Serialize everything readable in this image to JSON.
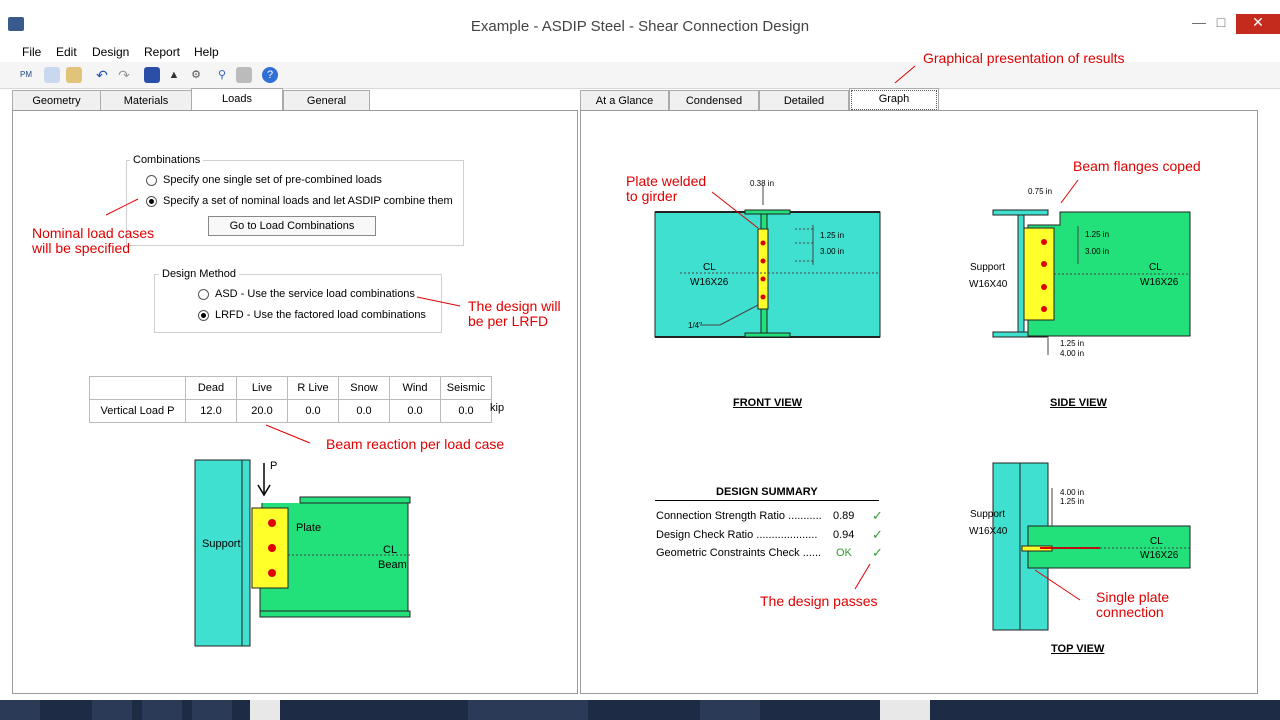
{
  "window": {
    "title": "Example - ASDIP Steel - Shear Connection Design"
  },
  "menu": {
    "items": [
      "File",
      "Edit",
      "Design",
      "Report",
      "Help"
    ]
  },
  "left_tabs": [
    "Geometry",
    "Materials",
    "Loads",
    "General"
  ],
  "right_tabs": [
    "At a Glance",
    "Condensed",
    "Detailed",
    "Graph"
  ],
  "combinations": {
    "label": "Combinations",
    "option1": "Specify one single set of pre-combined loads",
    "option2": "Specify a set of nominal loads and let ASDIP combine them",
    "button": "Go to Load Combinations",
    "selected": 2
  },
  "design_method": {
    "label": "Design Method",
    "option1": "ASD - Use the service load combinations",
    "option2": "LRFD - Use the factored load combinations",
    "selected": 2
  },
  "loads_table": {
    "headers": [
      "Dead",
      "Live",
      "R Live",
      "Snow",
      "Wind",
      "Seismic"
    ],
    "row_label": "Vertical Load  P",
    "values": [
      "12.0",
      "20.0",
      "0.0",
      "0.0",
      "0.0",
      "0.0"
    ],
    "unit": "kip"
  },
  "left_diagram": {
    "load_label": "P",
    "support": "Support",
    "plate": "Plate",
    "cl": "CL",
    "beam": "Beam"
  },
  "annotations": {
    "graphical": "Graphical presentation of results",
    "nominal1": "Nominal load cases",
    "nominal2": "will be specified",
    "lrfd1": "The design will",
    "lrfd2": "be per LRFD",
    "reaction": "Beam reaction per load case",
    "plate_welded1": "Plate welded",
    "plate_welded2": "to girder",
    "flanges": "Beam flanges coped",
    "passes": "The design passes",
    "single1": "Single plate",
    "single2": "connection"
  },
  "front_view": {
    "title": "FRONT VIEW",
    "dim_top": "0.38 in",
    "dim1": "1.25 in",
    "dim2": "3.00 in",
    "cl": "CL",
    "section": "W16X26",
    "weld": "1/4\""
  },
  "side_view": {
    "title": "SIDE VIEW",
    "dim_top": "0.75 in",
    "dim1": "1.25 in",
    "dim2": "3.00 in",
    "support": "Support",
    "support_section": "W16X40",
    "cl": "CL",
    "section": "W16X26",
    "dim_b1": "1.25 in",
    "dim_b2": "4.00 in"
  },
  "top_view": {
    "title": "TOP VIEW",
    "dim1": "4.00 in",
    "dim2": "1.25 in",
    "support": "Support",
    "support_section": "W16X40",
    "cl": "CL",
    "section": "W16X26"
  },
  "summary": {
    "title": "DESIGN SUMMARY",
    "rows": [
      {
        "label": "Connection Strength Ratio  ...........",
        "value": "0.89",
        "check": "✓"
      },
      {
        "label": "Design Check Ratio ....................",
        "value": "0.94",
        "check": "✓"
      },
      {
        "label": "Geometric Constraints Check  ......",
        "value": "OK",
        "check": "✓"
      }
    ]
  },
  "colors": {
    "steel": "#40e0d0",
    "beam": "#22e07a",
    "plate": "#ffff2a",
    "annotation": "#e00000",
    "check": "#2e9e2e"
  }
}
